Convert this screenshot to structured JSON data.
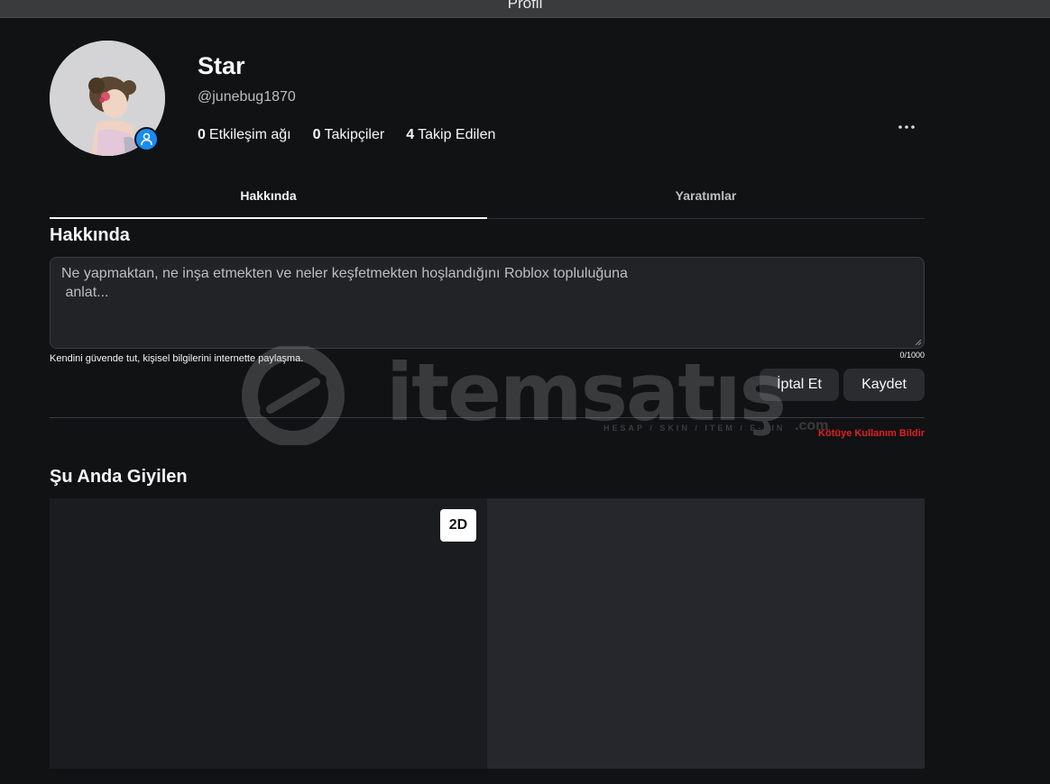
{
  "window": {
    "title": "Profil"
  },
  "profile": {
    "display_name": "Star",
    "username": "@junebug1870",
    "stats": [
      {
        "count": "0",
        "label": "Etkileşim ağı"
      },
      {
        "count": "0",
        "label": "Takipçiler"
      },
      {
        "count": "4",
        "label": "Takip Edilen"
      }
    ]
  },
  "tabs": [
    {
      "label": "Hakkında",
      "active": true
    },
    {
      "label": "Yaratımlar",
      "active": false
    }
  ],
  "about": {
    "title": "Hakkında",
    "placeholder": "Ne yapmaktan, ne inşa etmekten ve neler keşfetmekten hoşlandığını Roblox topluluğuna\n anlat...",
    "safety_note": "Kendini güvende tut, kişisel bilgilerini internette paylaşma.",
    "char_count": "0/1000",
    "cancel_label": "İptal Et",
    "save_label": "Kaydet",
    "report_label": "Kötüye Kullanım Bildir"
  },
  "wearing": {
    "title": "Şu Anda Giyilen",
    "toggle_label": "2D"
  },
  "watermark": {
    "brand": "itemsatış",
    "tagline": "HESAP / SKIN / ITEM / E-PIN",
    "suffix": ".com"
  },
  "icons": {
    "avatar_badge": "person-icon",
    "more": "ellipsis-icon"
  },
  "colors": {
    "background": "#111214",
    "badge": "#1a8cf0",
    "report": "#e02020"
  }
}
